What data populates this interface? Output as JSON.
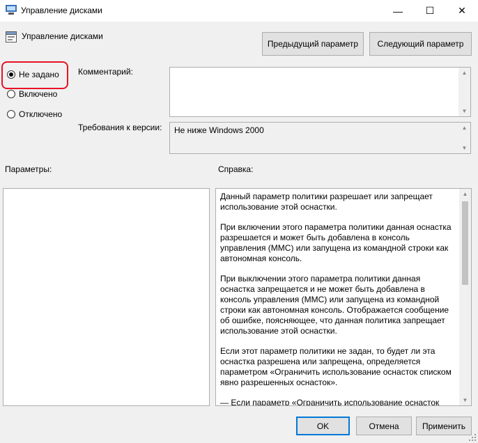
{
  "window": {
    "title": "Управление дисками",
    "minimize": "—",
    "maximize": "☐",
    "close": "✕"
  },
  "header": {
    "policy_name": "Управление дисками",
    "prev_label": "Предыдущий параметр",
    "next_label": "Следующий параметр"
  },
  "state": {
    "not_configured": "Не задано",
    "enabled": "Включено",
    "disabled": "Отключено",
    "selected": "not_configured"
  },
  "comment": {
    "label": "Комментарий:",
    "value": ""
  },
  "version": {
    "label": "Требования к версии:",
    "value": "Не ниже Windows 2000"
  },
  "options": {
    "label": "Параметры:"
  },
  "help": {
    "label": "Справка:",
    "paragraphs": [
      "Данный параметр политики разрешает или запрещает использование этой оснастки.",
      "При включении этого параметра политики данная оснастка разрешается и может быть добавлена в консоль управления (MMC) или запущена из командной строки как автономная консоль.",
      "При выключении этого параметра политики данная оснастка запрещается и не может быть добавлена в консоль управления (MMC) или запущена из командной строки как автономная консоль. Отображается сообщение об ошибке, поясняющее, что данная политика запрещает использование этой оснастки.",
      "Если этот параметр политики не задан, то будет ли эта оснастка разрешена или запрещена, определяется параметром «Ограничить использование оснасток списком явно разрешенных оснасток».",
      "— Если параметр «Ограничить использование оснасток"
    ]
  },
  "footer": {
    "ok": "OK",
    "cancel": "Отмена",
    "apply": "Применить"
  },
  "colors": {
    "accent": "#0078d7",
    "highlight": "#e81123"
  }
}
